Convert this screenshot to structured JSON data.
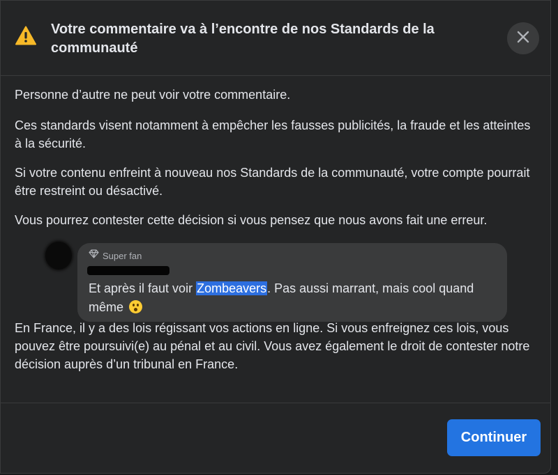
{
  "dialog": {
    "title": "Votre commentaire va à l’encontre de nos Standards de la communauté",
    "close_icon": "close-icon",
    "warning_icon": "warning-triangle-icon",
    "warning_color": "#f7b928"
  },
  "body": {
    "p1": "Personne d’autre ne peut voir votre commentaire.",
    "p2": "Ces standards visent notamment à empêcher les fausses publicités, la fraude et les atteintes à la sécurité.",
    "p3": "Si votre contenu enfreint à nouveau nos Standards de la communauté, votre compte pourrait être restreint ou désactivé.",
    "p4": "Vous pourrez contester cette décision si vous pensez que nous avons fait une erreur.",
    "p5": "En France, il y a des lois régissant vos actions en ligne. Si vous enfreignez ces lois, vous pouvez être poursuivi(e) au pénal et au civil. Vous avez également le droit de contester notre décision auprès d’un tribunal en France."
  },
  "comment": {
    "badge_icon": "diamond-icon",
    "badge_label": "Super fan",
    "text_before": "Et après il faut voir ",
    "highlighted": "Zombeavers",
    "text_after": ". Pas aussi marrant, mais cool quand même",
    "emoji": "astonished-face-emoji"
  },
  "footer": {
    "continue_label": "Continuer",
    "accent": "#2374e1"
  }
}
